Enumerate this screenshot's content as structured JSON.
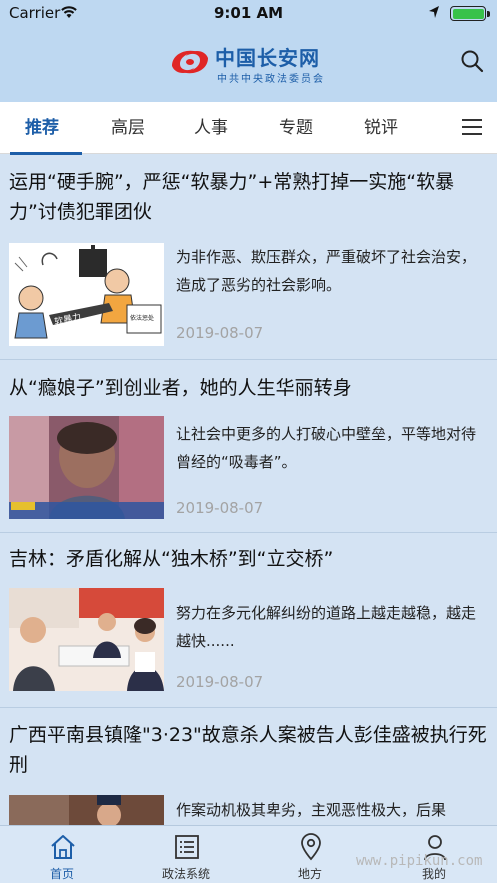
{
  "status_bar": {
    "carrier": "Carrier",
    "time": "9:01 AM"
  },
  "header": {
    "app_name": "中国长安网",
    "subtitle": "中共中央政法委员会",
    "brand_color": "#1d5ea8",
    "logo_color": "#e02626"
  },
  "tabs": [
    {
      "label": "推荐",
      "active": true
    },
    {
      "label": "高层",
      "active": false
    },
    {
      "label": "人事",
      "active": false
    },
    {
      "label": "专题",
      "active": false
    },
    {
      "label": "锐评",
      "active": false
    }
  ],
  "articles": [
    {
      "title": "运用“硬手腕”，严惩“软暴力”+常熟打掉一实施“软暴力”讨债犯罪团伙",
      "summary": "为非作恶、欺压群众，严重破坏了社会治安，造成了恶劣的社会影响。",
      "date": "2019-08-07",
      "thumb_text": [
        "软暴力",
        "依法惩处"
      ]
    },
    {
      "title": "从“瘾娘子”到创业者，她的人生华丽转身",
      "summary": "让社会中更多的人打破心中壁垒，平等地对待曾经的“吸毒者”。",
      "date": "2019-08-07"
    },
    {
      "title": "吉林：矛盾化解从“独木桥”到“立交桥”",
      "summary": "努力在多元化解纠纷的道路上越走越稳，越走越快......",
      "date": "2019-08-07"
    },
    {
      "title": "广西平南县镇隆\"3·23\"故意杀人案被告人彭佳盛被执行死刑",
      "summary": "作案动机极其卑劣，主观恶性极大，后果"
    }
  ],
  "bottom_nav": [
    {
      "label": "首页",
      "icon": "home-icon",
      "active": true
    },
    {
      "label": "政法系统",
      "icon": "list-icon",
      "active": false
    },
    {
      "label": "地方",
      "icon": "location-pin-icon",
      "active": false
    },
    {
      "label": "我的",
      "icon": "user-icon",
      "active": false
    }
  ],
  "watermark": "www.pipikun.com"
}
